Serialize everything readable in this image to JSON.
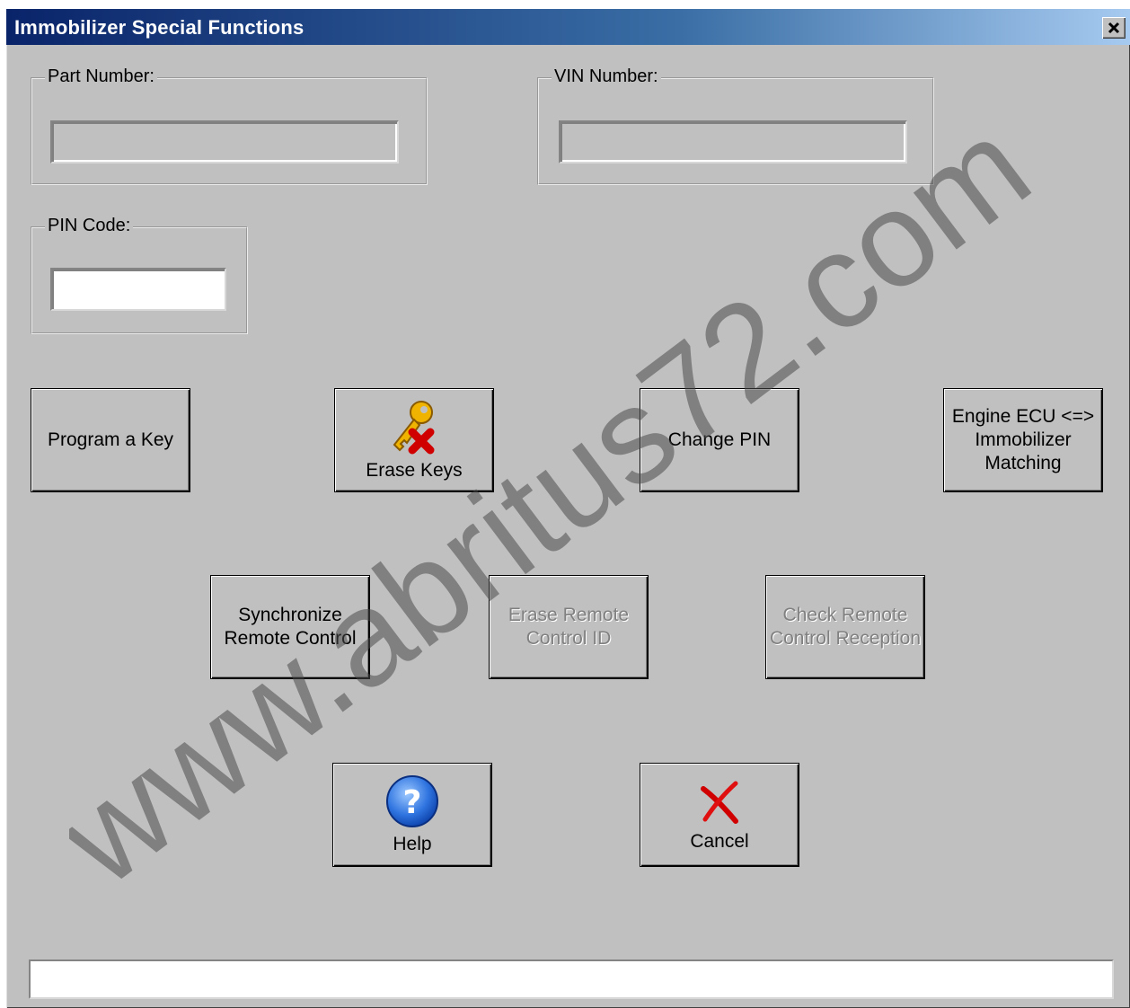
{
  "window": {
    "title": "Immobilizer Special Functions",
    "close_label": "✕"
  },
  "fields": {
    "part_number": {
      "label": "Part Number:",
      "value": ""
    },
    "vin_number": {
      "label": "VIN Number:",
      "value": ""
    },
    "pin_code": {
      "label": "PIN Code:",
      "value": ""
    }
  },
  "buttons": {
    "program_key": "Program a Key",
    "erase_keys": "Erase Keys",
    "change_pin": "Change PIN",
    "ecu_matching": "Engine ECU <=>\nImmobilizer\nMatching",
    "sync_remote": "Synchronize\nRemote Control",
    "erase_remote": "Erase Remote\nControl ID",
    "check_remote": "Check Remote\nControl Reception",
    "help": "Help",
    "cancel": "Cancel"
  },
  "status_bar": {
    "text": ""
  },
  "watermark": "www.abritus72.com",
  "icons": {
    "erase_keys": "key-erase-icon",
    "help": "help-icon",
    "cancel": "cancel-x-icon"
  }
}
